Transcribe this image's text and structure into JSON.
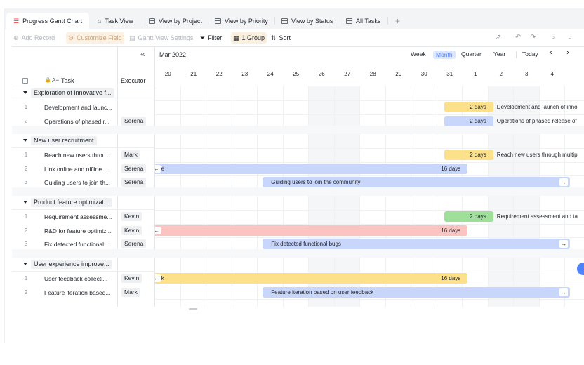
{
  "tabs": [
    {
      "label": "Progress Gantt Chart",
      "icon": "gantt-icon"
    },
    {
      "label": "Task View",
      "icon": "kanban-icon"
    },
    {
      "label": "View by Project",
      "icon": "grid-icon"
    },
    {
      "label": "View by Priority",
      "icon": "grid-icon"
    },
    {
      "label": "View by Status",
      "icon": "grid-icon"
    },
    {
      "label": "All Tasks",
      "icon": "grid-icon"
    },
    {
      "label": "+",
      "icon": "plus-icon"
    }
  ],
  "toolbar": {
    "add_record": "Add Record",
    "customize_field": "Customize Field",
    "gantt_settings": "Gantt View Settings",
    "filter": "Filter",
    "group": "1 Group",
    "sort": "Sort"
  },
  "header": {
    "task_col": "Task",
    "executor_col": "Executor",
    "month": "Mar 2022",
    "collapse": "«",
    "views": [
      "Week",
      "Month",
      "Quarter",
      "Year"
    ],
    "selected_view": "Month",
    "today": "Today",
    "prev": "‹",
    "next": "›",
    "days": [
      "20",
      "21",
      "22",
      "23",
      "24",
      "25",
      "26",
      "27",
      "28",
      "29",
      "30",
      "31",
      "1",
      "2",
      "3",
      "4"
    ]
  },
  "groups": [
    {
      "name": "Exploration of innovative f...",
      "rows": [
        {
          "num": "1",
          "task": "Development and launc...",
          "executor": "",
          "bar_label": "2 days",
          "bar_color": "#fde08a",
          "bar_text": "Development and launch of inno"
        },
        {
          "num": "2",
          "task": "Operations of phased r...",
          "executor": "Serena",
          "bar_label": "2 days",
          "bar_color": "#c8d6fb",
          "bar_text": "Operations of phased release of"
        }
      ]
    },
    {
      "name": "New user recruitment",
      "rows": [
        {
          "num": "1",
          "task": "Reach new users throu...",
          "executor": "Mark",
          "bar_label": "2 days",
          "bar_color": "#fde08a",
          "bar_text": "Reach new users through multip"
        },
        {
          "num": "2",
          "task": "Link online and offline ...",
          "executor": "Serena",
          "bar_label": "16 days",
          "bar_color": "#c8d6fb",
          "bar_text": "e"
        },
        {
          "num": "3",
          "task": "Guiding users to join th...",
          "executor": "Serena",
          "bar_label": "",
          "bar_color": "#c8d6fb",
          "bar_text": "Guiding users to join the community"
        }
      ]
    },
    {
      "name": "Product feature optimizat...",
      "rows": [
        {
          "num": "1",
          "task": "Requirement assessme...",
          "executor": "Kevin",
          "bar_label": "2 days",
          "bar_color": "#9edf9a",
          "bar_text": "Requirement assessment and ta"
        },
        {
          "num": "2",
          "task": "R&D for feature optimiz...",
          "executor": "Kevin",
          "bar_label": "16 days",
          "bar_color": "#fbc4c1",
          "bar_text": ""
        },
        {
          "num": "3",
          "task": "Fix detected functional ...",
          "executor": "Serena",
          "bar_label": "",
          "bar_color": "#c8d6fb",
          "bar_text": "Fix detected functional bugs"
        }
      ]
    },
    {
      "name": "User experience improve...",
      "rows": [
        {
          "num": "1",
          "task": "User feedback collecti...",
          "executor": "Kevin",
          "bar_label": "16 days",
          "bar_color": "#fde08a",
          "bar_text": "k"
        },
        {
          "num": "2",
          "task": "Feature iteration based...",
          "executor": "Mark",
          "bar_label": "",
          "bar_color": "#c8d6fb",
          "bar_text": "Feature iteration based on user feedback"
        }
      ]
    }
  ]
}
